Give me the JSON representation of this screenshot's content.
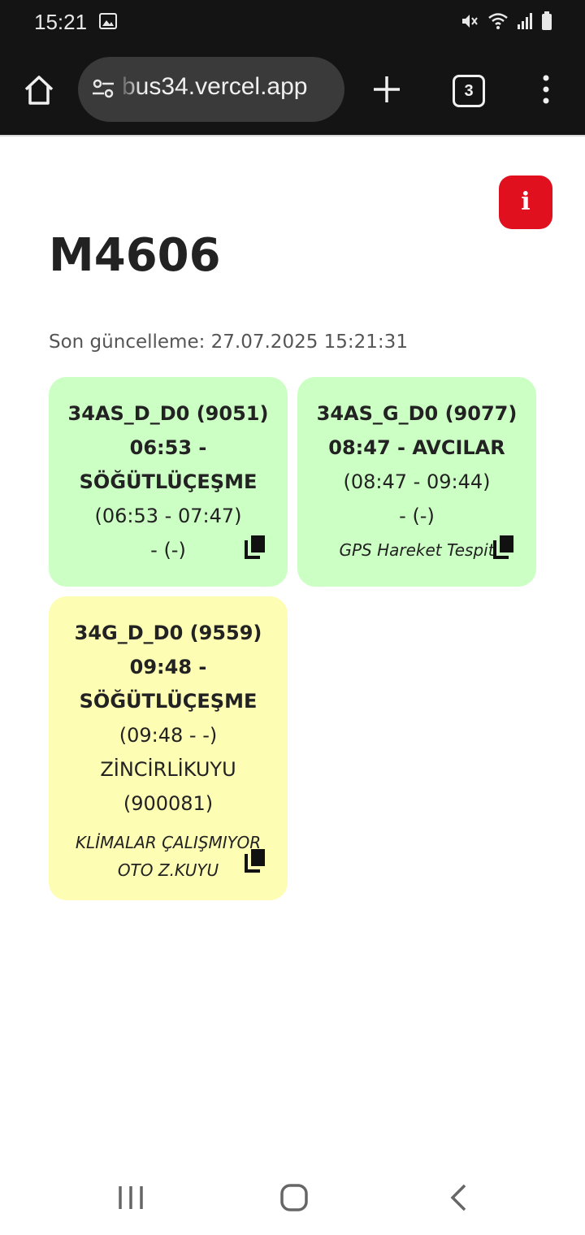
{
  "status": {
    "time": "15:21"
  },
  "browser": {
    "url": "bus34.vercel.app",
    "tab_count": "3"
  },
  "page": {
    "info_label": "i",
    "title": "M4606",
    "updated": "Son güncelleme: 27.07.2025 15:21:31"
  },
  "cards": [
    {
      "color": "#ccffc4",
      "code": "34AS_D_D0 (9051)",
      "trip_a": "06:53 -",
      "trip_b": "SÖĞÜTLÜÇEŞME",
      "times": "(06:53 - 07:47)",
      "extra": "- (-)"
    },
    {
      "color": "#ccffc4",
      "code": "34AS_G_D0 (9077)",
      "trip": "08:47 - AVCILAR",
      "times": "(08:47 - 09:44)",
      "extra": "- (-)",
      "note": "GPS Hareket Tespit"
    },
    {
      "color": "#fdfdb4",
      "code": "34G_D_D0 (9559)",
      "trip_a": "09:48 -",
      "trip_b": "SÖĞÜTLÜÇEŞME",
      "times": "(09:48 - -)",
      "stop": "ZİNCİRLİKUYU",
      "stop_id": "(900081)",
      "note_a": "KLİMALAR ÇALIŞMIYOR",
      "note_b": "OTO Z.KUYU"
    }
  ]
}
